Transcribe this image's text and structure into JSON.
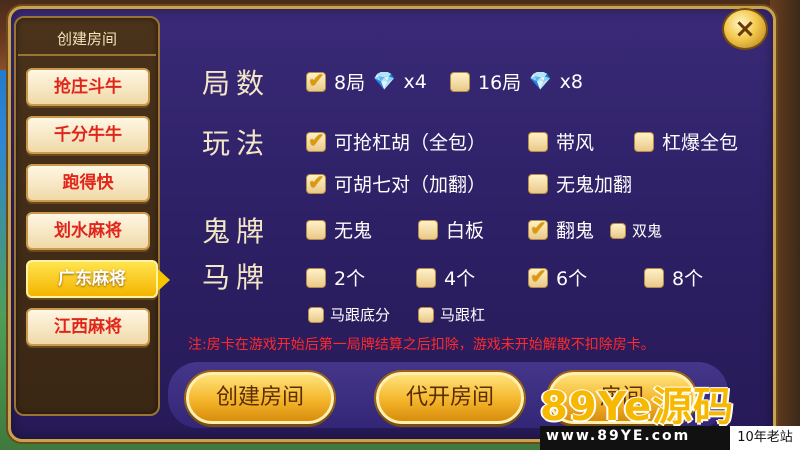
{
  "sidebar": {
    "title": "创建房间",
    "items": [
      {
        "label": "抢庄斗牛",
        "active": false
      },
      {
        "label": "千分牛牛",
        "active": false
      },
      {
        "label": "跑得快",
        "active": false
      },
      {
        "label": "划水麻将",
        "active": false
      },
      {
        "label": "广东麻将",
        "active": true
      },
      {
        "label": "江西麻将",
        "active": false
      }
    ]
  },
  "close_label": "×",
  "rounds": {
    "label": "局数",
    "options": [
      {
        "label": "8局",
        "cost": "x4",
        "checked": true
      },
      {
        "label": "16局",
        "cost": "x8",
        "checked": false
      }
    ]
  },
  "rules": {
    "label": "玩法",
    "options": [
      {
        "label": "可抢杠胡（全包）",
        "checked": true
      },
      {
        "label": "带风",
        "checked": false
      },
      {
        "label": "杠爆全包",
        "checked": false
      },
      {
        "label": "可胡七对（加翻）",
        "checked": true
      },
      {
        "label": "无鬼加翻",
        "checked": false
      }
    ]
  },
  "ghost": {
    "label": "鬼牌",
    "options": [
      {
        "label": "无鬼",
        "checked": false
      },
      {
        "label": "白板",
        "checked": false
      },
      {
        "label": "翻鬼",
        "checked": true
      },
      {
        "label": "双鬼",
        "checked": false
      }
    ]
  },
  "horse": {
    "label": "马牌",
    "options": [
      {
        "label": "2个",
        "checked": false
      },
      {
        "label": "4个",
        "checked": false
      },
      {
        "label": "6个",
        "checked": true
      },
      {
        "label": "8个",
        "checked": false
      },
      {
        "label": "马跟底分",
        "checked": false
      },
      {
        "label": "马跟杠",
        "checked": false
      }
    ]
  },
  "notice": "注:房卡在游戏开始后第一局牌结算之后扣除，游戏未开始解散不扣除房卡。",
  "buttons": {
    "create": "创建房间",
    "proxy": "代开房间",
    "third": "房间"
  },
  "watermark": {
    "main": "89Ye源码",
    "url": "www.89YE.com",
    "tag": "10年老站"
  },
  "colors": {
    "accent": "#f4b400",
    "panel": "#2c1f63",
    "notice": "#ff2a2a"
  },
  "icons": {
    "close": "close-icon",
    "diamond": "diamond-icon",
    "check": "checkmark-icon"
  }
}
